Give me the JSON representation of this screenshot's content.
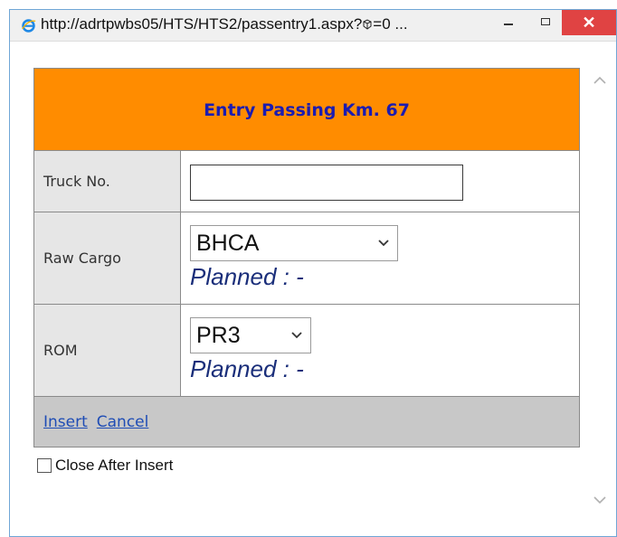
{
  "window": {
    "title": "http://adrtpwbs05/HTS/HTS2/passentry1.aspx?",
    "title_suffix": "=0 ...",
    "min_glyph": "–",
    "max_glyph": "□",
    "close_glyph": "✕"
  },
  "form": {
    "header": "Entry Passing Km. 67",
    "truck": {
      "label": "Truck No.",
      "value": ""
    },
    "cargo": {
      "label": "Raw Cargo",
      "selected": "BHCA",
      "planned": "Planned : -"
    },
    "rom": {
      "label": "ROM",
      "selected": "PR3",
      "planned": "Planned : -"
    },
    "actions": {
      "insert": "Insert",
      "cancel": "Cancel"
    },
    "close_after_insert": {
      "label": "Close After Insert",
      "checked": false
    }
  },
  "colors": {
    "header_bg": "#ff8c00",
    "header_text": "#1c1cb0",
    "link": "#1f4db5",
    "planned_text": "#1a2e7a",
    "close_button": "#e04343"
  },
  "icons": [
    "ie-icon",
    "dice-icon",
    "minimize-icon",
    "maximize-icon",
    "close-icon",
    "chevron-down-icon",
    "scroll-up-icon",
    "scroll-down-icon"
  ]
}
